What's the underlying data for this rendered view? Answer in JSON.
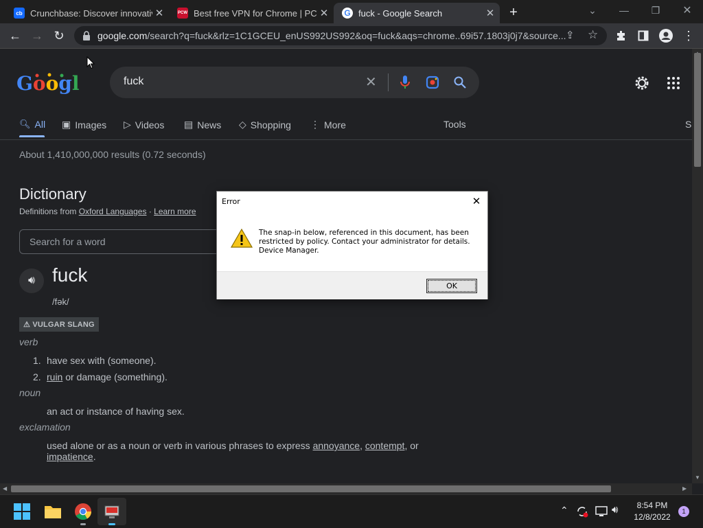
{
  "tabs": [
    {
      "favicon_text": "cb",
      "favicon_color": "#146aff",
      "title": "Crunchbase: Discover innovative"
    },
    {
      "favicon_text": "PCW",
      "favicon_color": "#c8102e",
      "title": "Best free VPN for Chrome | PCW"
    },
    {
      "favicon_text": "G",
      "favicon_color": "#ffffff",
      "title": "fuck - Google Search"
    }
  ],
  "toolbar": {
    "url_domain": "google.com",
    "url_path": "/search?q=fuck&rlz=1C1GCEU_enUS992US992&oq=fuck&aqs=chrome..69i57.1803j0j7&source..."
  },
  "search": {
    "query": "fuck"
  },
  "nav_tabs": [
    "All",
    "Images",
    "Videos",
    "News",
    "Shopping",
    "More"
  ],
  "tools_label": "Tools",
  "results_stats": "About 1,410,000,000 results (0.72 seconds)",
  "dictionary": {
    "heading": "Dictionary",
    "definitions_from": "Definitions from",
    "source": "Oxford Languages",
    "separator": "·",
    "learn_more": "Learn more",
    "search_placeholder": "Search for a word",
    "word": "fuck",
    "pronunciation": "/fək/",
    "register": "VULGAR SLANG",
    "verb_label": "verb",
    "verb_1_num": "1.",
    "verb_1": "have sex with (someone).",
    "verb_2_num": "2.",
    "verb_2_link": "ruin",
    "verb_2_rest": " or damage (something).",
    "noun_label": "noun",
    "noun_def": "an act or instance of having sex.",
    "excl_label": "exclamation",
    "excl_prefix": "used alone or as a noun or verb in various phrases to express ",
    "excl_link1": "annoyance",
    "excl_sep1": ", ",
    "excl_link2": "contempt",
    "excl_sep2": ", or",
    "excl_link3": "impatience",
    "excl_end": "."
  },
  "dialog": {
    "title": "Error",
    "message": "The snap-in below, referenced in this document, has been restricted by policy. Contact your administrator for details. Device Manager.",
    "ok_label": "OK"
  },
  "taskbar": {
    "time": "8:54 PM",
    "date": "12/8/2022",
    "notification_count": "1"
  },
  "colors": {
    "accent": "#8ab4f8",
    "page_bg": "#202124",
    "dialog_bg": "#ffffff"
  }
}
